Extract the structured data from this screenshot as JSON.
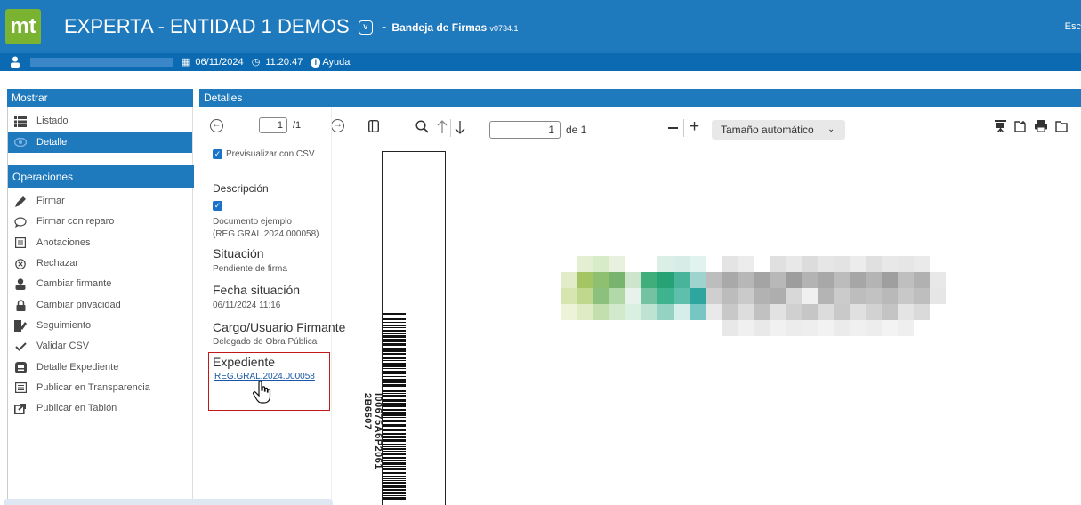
{
  "header": {
    "logo": "mt",
    "app_title": "EXPERTA - ENTIDAD 1 DEMOS",
    "separator": "-",
    "subtitle": "Bandeja de Firmas",
    "version": "v0734.1",
    "right_text": "Esc"
  },
  "userbar": {
    "date": "06/11/2024",
    "time": "11:20:47",
    "help": "Ayuda"
  },
  "left": {
    "mostrar_title": "Mostrar",
    "mostrar_items": [
      {
        "label": "Listado",
        "icon": "list-icon"
      },
      {
        "label": "Detalle",
        "icon": "eye-icon",
        "selected": true
      }
    ],
    "operaciones_title": "Operaciones",
    "operaciones_items": [
      {
        "label": "Firmar",
        "icon": "pen-icon"
      },
      {
        "label": "Firmar con reparo",
        "icon": "comment-icon"
      },
      {
        "label": "Anotaciones",
        "icon": "notes-icon"
      },
      {
        "label": "Rechazar",
        "icon": "reject-icon"
      },
      {
        "label": "Cambiar firmante",
        "icon": "user-icon"
      },
      {
        "label": "Cambiar privacidad",
        "icon": "lock-icon"
      },
      {
        "label": "Seguimiento",
        "icon": "tracking-icon"
      },
      {
        "label": "Validar CSV",
        "icon": "check-icon"
      },
      {
        "label": "Detalle Expediente",
        "icon": "folder-icon"
      },
      {
        "label": "Publicar en Transparencia",
        "icon": "publish-icon"
      },
      {
        "label": "Publicar en Tablón",
        "icon": "share-icon"
      }
    ]
  },
  "details": {
    "title": "Detalles",
    "page_current": "1",
    "page_total": "/1",
    "preview_csv": "Previsualizar con CSV",
    "descripcion_label": "Descripción",
    "descripcion_value_1": "Documento ejemplo",
    "descripcion_value_2": "(REG.GRAL.2024.000058)",
    "situacion_label": "Situación",
    "situacion_value": "Pendiente de firma",
    "fecha_label": "Fecha situación",
    "fecha_value": "06/11/2024 11:16",
    "cargo_label": "Cargo/Usuario Firmante",
    "cargo_value": "Delegado de Obra Pública",
    "expediente_label": "Expediente",
    "expediente_link": "REG.GRAL.2024.000058"
  },
  "viewer": {
    "page_input": "1",
    "page_of": "de 1",
    "zoom_select": "Tamaño automático",
    "doc_code": "I00675A6P2061 2B6507"
  },
  "colors": {
    "primary": "#1f79bd",
    "dark": "#0b6ab1",
    "highlight_border": "#c0171b",
    "logo_green": "#7ab331"
  }
}
